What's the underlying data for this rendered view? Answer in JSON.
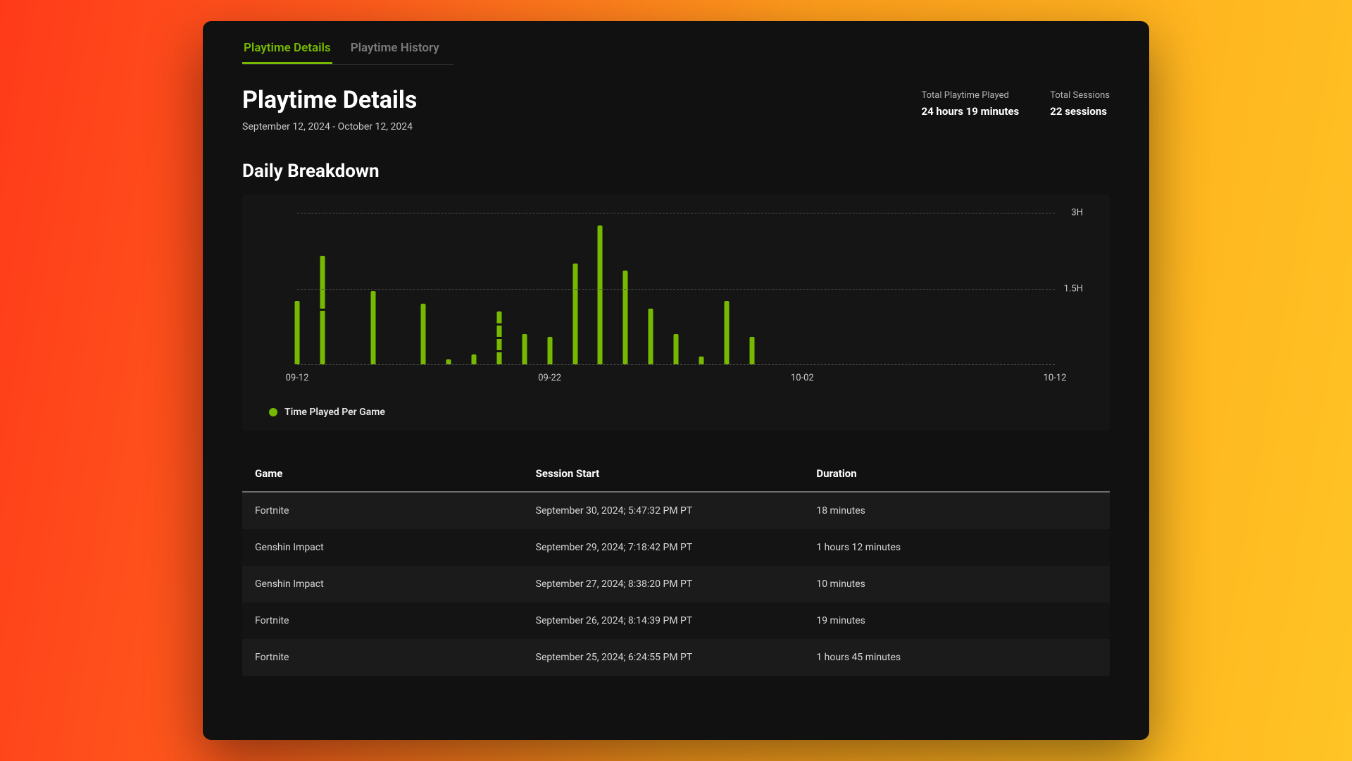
{
  "tabs": [
    {
      "label": "Playtime Details",
      "active": true
    },
    {
      "label": "Playtime History",
      "active": false
    }
  ],
  "header": {
    "title": "Playtime Details",
    "date_range": "September 12, 2024 - October 12, 2024"
  },
  "stats": {
    "total_playtime_label": "Total Playtime Played",
    "total_playtime_value": "24 hours 19 minutes",
    "total_sessions_label": "Total Sessions",
    "total_sessions_value": "22 sessions"
  },
  "section_title": "Daily Breakdown",
  "legend_label": "Time Played Per Game",
  "chart_data": {
    "type": "bar",
    "title": "Daily Breakdown",
    "ylabel": "Hours",
    "ylim": [
      0,
      3
    ],
    "yticks": [
      {
        "value": 1.5,
        "label": "1.5H"
      },
      {
        "value": 3,
        "label": "3H"
      }
    ],
    "xticks": [
      "09-12",
      "09-22",
      "10-02",
      "10-12"
    ],
    "xrange_days": 30,
    "categories": [
      "09-12",
      "09-13",
      "09-14",
      "09-15",
      "09-16",
      "09-17",
      "09-18",
      "09-19",
      "09-20",
      "09-21",
      "09-22",
      "09-23",
      "09-24",
      "09-25",
      "09-26",
      "09-27",
      "09-28",
      "09-29",
      "09-30"
    ],
    "series": [
      {
        "name": "Time Played Per Game",
        "values_hours": [
          1.25,
          2.15,
          0.0,
          1.45,
          0.0,
          1.2,
          0.1,
          0.2,
          1.05,
          0.6,
          0.55,
          2.0,
          2.75,
          1.85,
          1.1,
          0.6,
          0.15,
          1.25,
          0.55
        ],
        "segments": [
          1,
          2,
          0,
          1,
          0,
          1,
          1,
          1,
          4,
          1,
          1,
          1,
          1,
          1,
          1,
          1,
          1,
          1,
          1
        ]
      }
    ]
  },
  "table": {
    "columns": [
      "Game",
      "Session Start",
      "Duration"
    ],
    "rows": [
      {
        "game": "Fortnite",
        "start": "September 30, 2024; 5:47:32 PM PT",
        "duration": "18 minutes"
      },
      {
        "game": "Genshin Impact",
        "start": "September 29, 2024; 7:18:42 PM PT",
        "duration": "1 hours 12 minutes"
      },
      {
        "game": "Genshin Impact",
        "start": "September 27, 2024; 8:38:20 PM PT",
        "duration": "10 minutes"
      },
      {
        "game": "Fortnite",
        "start": "September 26, 2024; 8:14:39 PM PT",
        "duration": "19 minutes"
      },
      {
        "game": "Fortnite",
        "start": "September 25, 2024; 6:24:55 PM PT",
        "duration": "1 hours 45 minutes"
      }
    ]
  },
  "colors": {
    "accent": "#76b900",
    "panel": "#111111",
    "card": "#151515"
  }
}
